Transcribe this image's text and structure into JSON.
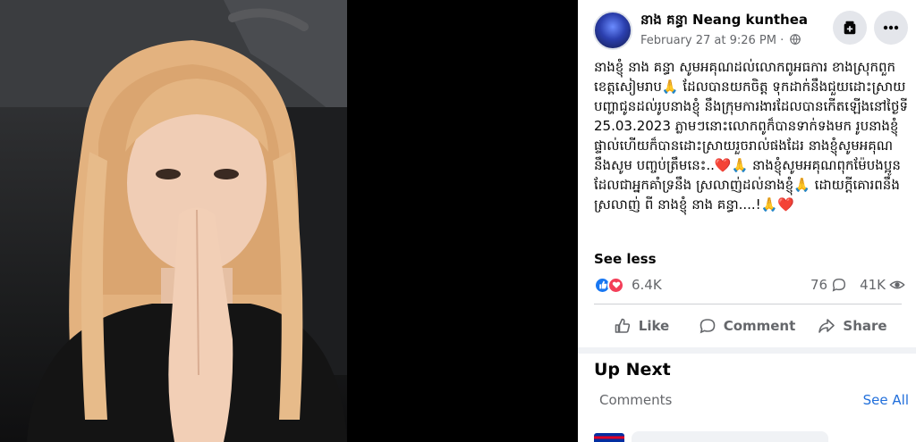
{
  "colors": {
    "accent": "#1877f2",
    "link": "#216fdb",
    "secondary_text": "#65676b",
    "love": "#f33e58"
  },
  "post": {
    "author": "នាង គន្ធា Neang kunthea",
    "timestamp": "February 27 at 9:26 PM",
    "separator": "·",
    "privacy_icon": "globe-icon",
    "text": "នាងខ្ញុំ នាង គន្ធា សូមអគុណដល់លោកពូអធការ ខាងស្រុកពួក ខេត្តសៀមរាប🙏 ដែលបានយកចិត្ត ទុកដាក់នឹងជួយដោះស្រាយបញ្ហាជូនដល់រូបនាងខ្ញុំ នឹងក្រុមការងារដែលបានកើតឡើងនៅថ្ងៃទី 25.03.2023 ភ្លាមៗនោះលោកពូក៏បានទាក់ទងមក រូបនាងខ្ញុំផ្ទាល់ហើយក៏បានដោះស្រាយរួចរាល់ផងដែរ នាងខ្ញុំសូមអគុណនឹងសូម បញ្ចប់ត្រឹមនេះ..❤️🙏 នាងខ្ញុំសូមអគុណពុកម៉ែបងប្អូនដែលជាអ្នកគាំទ្រនឹង ស្រលាញ់ដល់នាងខ្ញុំ🙏 ដោយក្ដីគោរពនឹងស្រលាញ់ ពី នាងខ្ញុំ នាង គន្ធា....!🙏❤️",
    "see_less": "See less"
  },
  "engagement": {
    "reactions_count": "6.4K",
    "comments_count": "76",
    "views_count": "41K"
  },
  "actions": {
    "like": "Like",
    "comment": "Comment",
    "share": "Share"
  },
  "up_next": {
    "title": "Up Next",
    "comments_label": "Comments",
    "see_all": "See All"
  }
}
